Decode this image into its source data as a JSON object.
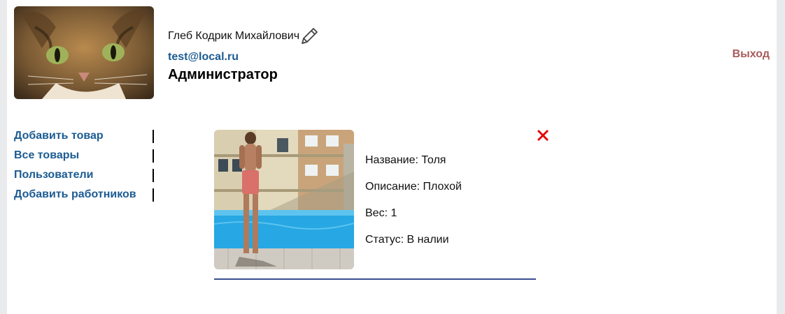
{
  "header": {
    "user_name": "Глеб Кодрик Михайлович",
    "email": "test@local.ru",
    "role": "Администратор",
    "logout_label": "Выход",
    "avatar_icon": "cat-photo",
    "edit_icon": "pencil-icon"
  },
  "sidebar": {
    "items": [
      {
        "label": "Добавить товар"
      },
      {
        "label": "Все товары"
      },
      {
        "label": "Пользователи"
      },
      {
        "label": "Добавить работников"
      }
    ]
  },
  "product": {
    "photo_icon": "product-photo",
    "delete_icon": "close-icon",
    "fields": [
      {
        "text": "Название: Толя"
      },
      {
        "text": "Описание: Плохой"
      },
      {
        "text": "Вес: 1"
      },
      {
        "text": "Статус: В налии"
      }
    ]
  },
  "colors": {
    "link": "#1b5b92",
    "logout": "#a85b5b",
    "delete": "#e60000",
    "divider": "#3a4e90"
  }
}
